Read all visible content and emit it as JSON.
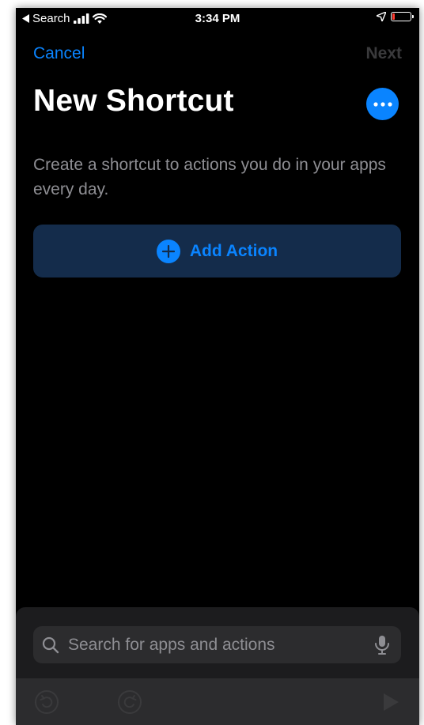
{
  "status_bar": {
    "back_app": "Search",
    "time": "3:34 PM"
  },
  "nav": {
    "cancel_label": "Cancel",
    "next_label": "Next"
  },
  "header": {
    "title": "New Shortcut"
  },
  "description": "Create a shortcut to actions you do in your apps every day.",
  "add_action": {
    "label": "Add Action"
  },
  "search": {
    "placeholder": "Search for apps and actions",
    "value": ""
  },
  "icons": {
    "more": "ellipsis-icon",
    "add": "plus-circle-icon",
    "search": "search-icon",
    "mic": "microphone-icon",
    "undo": "undo-icon",
    "redo": "redo-icon",
    "play": "play-icon"
  },
  "colors": {
    "accent": "#0a84ff",
    "background": "#000000",
    "add_action_bg": "#142c4b",
    "disabled": "#3a3a3c",
    "secondary_text": "#8e8e93",
    "battery_low": "#ff3b30"
  }
}
